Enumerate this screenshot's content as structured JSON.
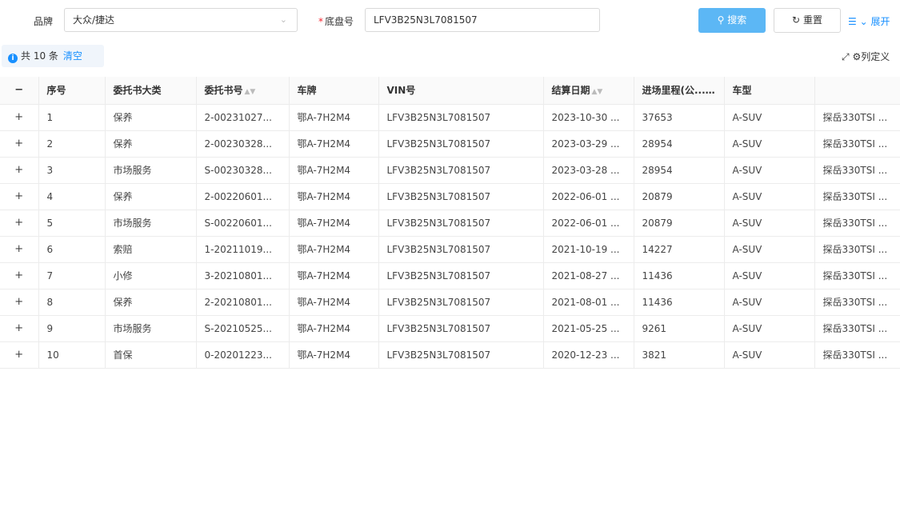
{
  "filters": {
    "brand_label": "品牌",
    "brand_value": "大众/捷达",
    "chassis_required": "*",
    "chassis_label": "底盘号",
    "chassis_value": "LFV3B25N3L7081507"
  },
  "toolbar": {
    "search_label": "搜索",
    "reset_label": "重置",
    "expand_label": "展开"
  },
  "summary": {
    "count_text": "共 10 条",
    "clear_label": "清空",
    "column_settings_label": "列定义"
  },
  "table": {
    "columns": [
      "−",
      "序号",
      "委托书大类",
      "委托书号",
      "车牌",
      "VIN号",
      "结算日期",
      "进场里程(公...",
      "车型",
      ""
    ],
    "rows": [
      [
        "+",
        "1",
        "保养",
        "2-00231027...",
        "鄂A-7H2M4",
        "LFV3B25N3L7081507",
        "2023-10-30 ...",
        "37653",
        "A-SUV",
        "探岳330TSI ..."
      ],
      [
        "+",
        "2",
        "保养",
        "2-00230328...",
        "鄂A-7H2M4",
        "LFV3B25N3L7081507",
        "2023-03-29 ...",
        "28954",
        "A-SUV",
        "探岳330TSI ..."
      ],
      [
        "+",
        "3",
        "市场服务",
        "S-00230328...",
        "鄂A-7H2M4",
        "LFV3B25N3L7081507",
        "2023-03-28 ...",
        "28954",
        "A-SUV",
        "探岳330TSI ..."
      ],
      [
        "+",
        "4",
        "保养",
        "2-00220601...",
        "鄂A-7H2M4",
        "LFV3B25N3L7081507",
        "2022-06-01 ...",
        "20879",
        "A-SUV",
        "探岳330TSI ..."
      ],
      [
        "+",
        "5",
        "市场服务",
        "S-00220601...",
        "鄂A-7H2M4",
        "LFV3B25N3L7081507",
        "2022-06-01 ...",
        "20879",
        "A-SUV",
        "探岳330TSI ..."
      ],
      [
        "+",
        "6",
        "索赔",
        "1-20211019...",
        "鄂A-7H2M4",
        "LFV3B25N3L7081507",
        "2021-10-19 ...",
        "14227",
        "A-SUV",
        "探岳330TSI ..."
      ],
      [
        "+",
        "7",
        "小修",
        "3-20210801...",
        "鄂A-7H2M4",
        "LFV3B25N3L7081507",
        "2021-08-27 ...",
        "11436",
        "A-SUV",
        "探岳330TSI ..."
      ],
      [
        "+",
        "8",
        "保养",
        "2-20210801...",
        "鄂A-7H2M4",
        "LFV3B25N3L7081507",
        "2021-08-01 ...",
        "11436",
        "A-SUV",
        "探岳330TSI ..."
      ],
      [
        "+",
        "9",
        "市场服务",
        "S-20210525...",
        "鄂A-7H2M4",
        "LFV3B25N3L7081507",
        "2021-05-25 ...",
        "9261",
        "A-SUV",
        "探岳330TSI ..."
      ],
      [
        "+",
        "10",
        "首保",
        "0-20201223...",
        "鄂A-7H2M4",
        "LFV3B25N3L7081507",
        "2020-12-23 ...",
        "3821",
        "A-SUV",
        "探岳330TSI ..."
      ]
    ]
  }
}
